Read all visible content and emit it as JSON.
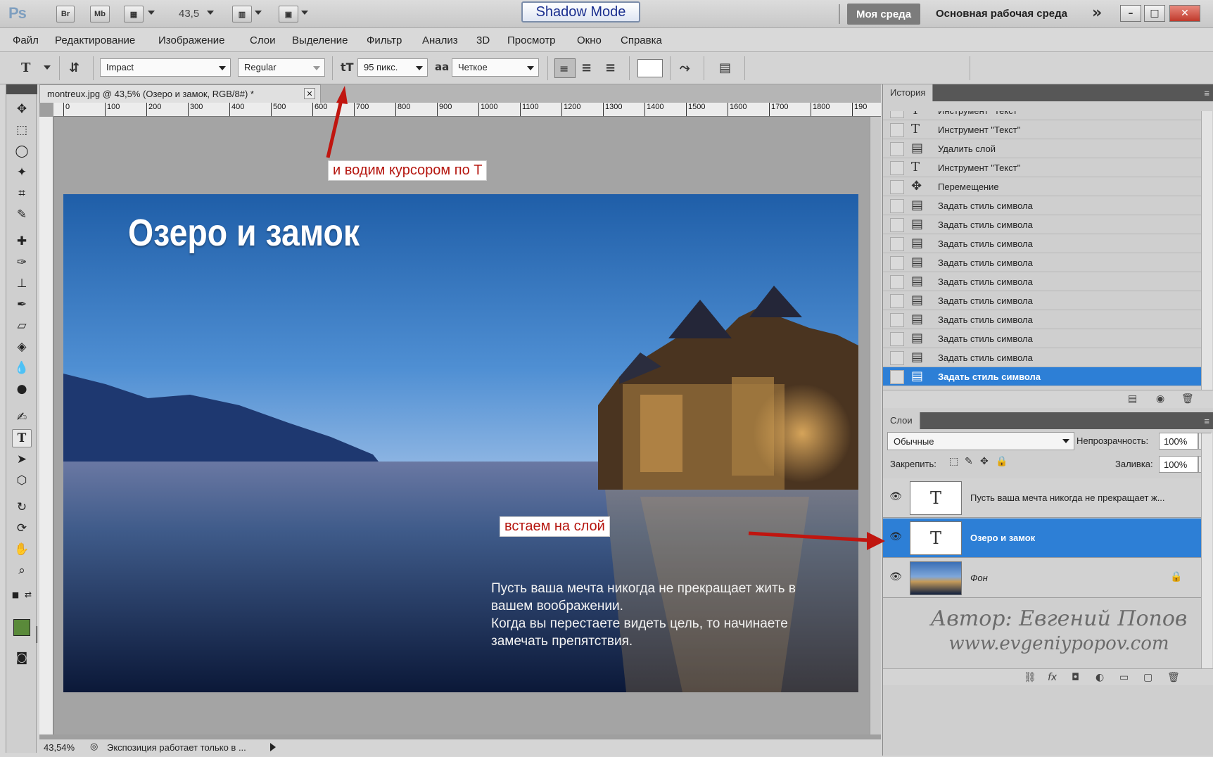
{
  "titlebar": {
    "app_logo": "Ps",
    "br_label": "Br",
    "mb_label": "Mb",
    "zoom_value": "43,5",
    "shadow_mode": "Shadow Mode",
    "workspace_active": "Моя среда",
    "workspace_main": "Основная рабочая среда",
    "more": "»"
  },
  "menu": {
    "items": [
      "Файл",
      "Редактирование",
      "Изображение",
      "Слои",
      "Выделение",
      "Фильтр",
      "Анализ",
      "3D",
      "Просмотр",
      "Окно",
      "Справка"
    ]
  },
  "options": {
    "font_family": "Impact",
    "font_style": "Regular",
    "font_size": "95 пикс.",
    "antialias_label": "aa",
    "antialias": "Четкое"
  },
  "document": {
    "tab_title": "montreux.jpg @ 43,5% (Озеро и замок, RGB/8#) *",
    "ruler_ticks": [
      "0",
      "100",
      "200",
      "300",
      "400",
      "500",
      "600",
      "700",
      "800",
      "900",
      "1000",
      "1100",
      "1200",
      "1300",
      "1400",
      "1500",
      "1600",
      "1700",
      "1800",
      "190"
    ],
    "image_title": "Озеро и замок",
    "image_quote_lines": [
      "Пусть ваша мечта никогда не прекращает жить в",
      "вашем воображении.",
      "Когда вы перестаете видеть цель, то начинаете",
      "замечать препятствия."
    ]
  },
  "status": {
    "zoom": "43,54%",
    "message": "Экспозиция работает только в ..."
  },
  "history": {
    "tab": "История",
    "items": [
      {
        "label": "Инструмент \"Текст\"",
        "icon": "T"
      },
      {
        "label": "Инструмент \"Текст\"",
        "icon": "T"
      },
      {
        "label": "Удалить слой",
        "icon": "doc"
      },
      {
        "label": "Инструмент \"Текст\"",
        "icon": "T"
      },
      {
        "label": "Перемещение",
        "icon": "move"
      },
      {
        "label": "Задать стиль символа",
        "icon": "doc"
      },
      {
        "label": "Задать стиль символа",
        "icon": "doc"
      },
      {
        "label": "Задать стиль символа",
        "icon": "doc"
      },
      {
        "label": "Задать стиль символа",
        "icon": "doc"
      },
      {
        "label": "Задать стиль символа",
        "icon": "doc"
      },
      {
        "label": "Задать стиль символа",
        "icon": "doc"
      },
      {
        "label": "Задать стиль символа",
        "icon": "doc"
      },
      {
        "label": "Задать стиль символа",
        "icon": "doc"
      },
      {
        "label": "Задать стиль символа",
        "icon": "doc"
      },
      {
        "label": "Задать стиль символа",
        "icon": "doc",
        "selected": true
      }
    ]
  },
  "layers": {
    "tab": "Слои",
    "blend_mode": "Обычные",
    "opacity_label": "Непрозрачность:",
    "opacity": "100%",
    "lock_label": "Закрепить:",
    "fill_label": "Заливка:",
    "fill": "100%",
    "items": [
      {
        "name": "Пусть ваша мечта никогда не прекращает ж...",
        "type": "text",
        "selected": false
      },
      {
        "name": "Озеро и замок",
        "type": "text",
        "selected": true
      },
      {
        "name": "Фон",
        "type": "image",
        "selected": false,
        "locked": true
      }
    ]
  },
  "watermark": {
    "author": "Автор: Евгений Попов",
    "url": "www.evgeniypopov.com"
  },
  "annotations": {
    "top": "и водим курсором по Т",
    "layer": "встаем на слой"
  },
  "colors": {
    "selection_blue": "#2d7fd6",
    "annotation_red": "#c0150f",
    "foreground": "#5a8a3a",
    "background": "#3b5b2a"
  }
}
